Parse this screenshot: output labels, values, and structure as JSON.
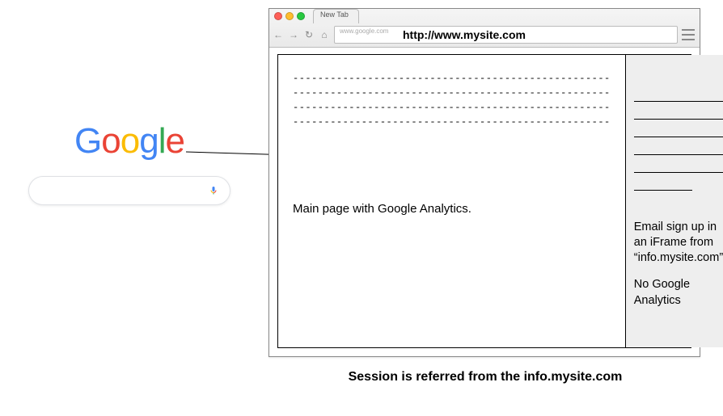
{
  "google": {
    "letters": [
      "G",
      "o",
      "o",
      "g",
      "l",
      "e"
    ],
    "search_placeholder": ""
  },
  "browser": {
    "tab_label": "New Tab",
    "url_old": "www.google.com",
    "url_new": "http://www.mysite.com",
    "main_text": "Main page with Google Analytics.",
    "sidebar_text_1": "Email sign up in an iFrame from “info.mysite.com”",
    "sidebar_text_2": "No Google Analytics"
  },
  "caption": "Session is referred from the info.mysite.com"
}
